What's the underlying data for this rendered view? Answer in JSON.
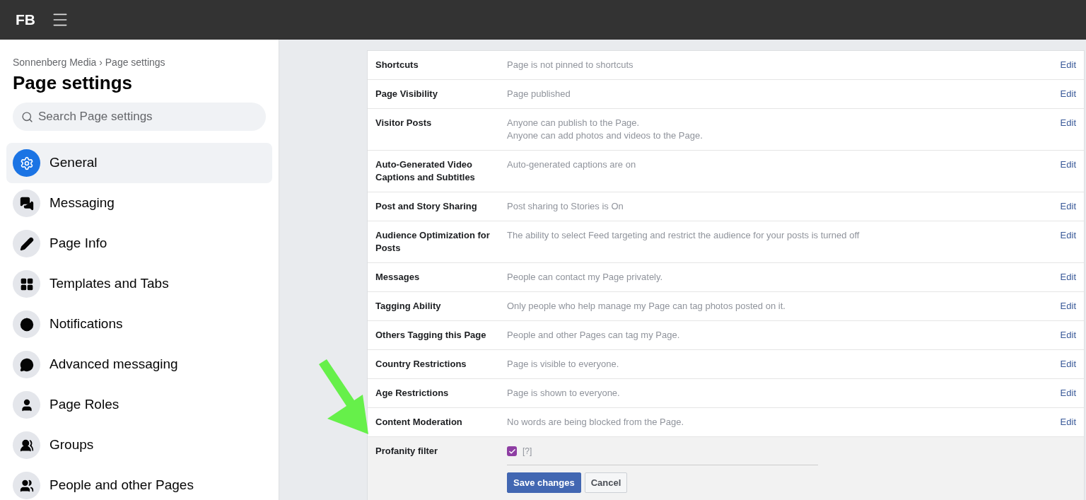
{
  "topbar": {
    "logo": "FB"
  },
  "sidebar": {
    "breadcrumb": "Sonnenberg Media › Page settings",
    "title": "Page settings",
    "search": {
      "placeholder": "Search Page settings"
    },
    "items": [
      {
        "label": "General",
        "selected": true
      },
      {
        "label": "Messaging",
        "selected": false
      },
      {
        "label": "Page Info",
        "selected": false
      },
      {
        "label": "Templates and Tabs",
        "selected": false
      },
      {
        "label": "Notifications",
        "selected": false
      },
      {
        "label": "Advanced messaging",
        "selected": false
      },
      {
        "label": "Page Roles",
        "selected": false
      },
      {
        "label": "Groups",
        "selected": false
      },
      {
        "label": "People and other Pages",
        "selected": false
      }
    ]
  },
  "settings": [
    {
      "kind": "setting",
      "name": "Shortcuts",
      "lines": [
        "Page is not pinned to shortcuts"
      ],
      "action": "Edit"
    },
    {
      "kind": "setting",
      "name": "Page Visibility",
      "lines": [
        "Page published"
      ],
      "action": "Edit"
    },
    {
      "kind": "setting",
      "name": "Visitor Posts",
      "lines": [
        "Anyone can publish to the Page.",
        "Anyone can add photos and videos to the Page."
      ],
      "action": "Edit"
    },
    {
      "kind": "setting",
      "name": "Auto-Generated Video Captions and Subtitles",
      "lines": [
        "Auto-generated captions are on"
      ],
      "action": "Edit"
    },
    {
      "kind": "setting",
      "name": "Post and Story Sharing",
      "lines": [
        "Post sharing to Stories is On"
      ],
      "action": "Edit"
    },
    {
      "kind": "setting",
      "name": "Audience Optimization for Posts",
      "lines": [
        "The ability to select Feed targeting and restrict the audience for your posts is turned off"
      ],
      "action": "Edit"
    },
    {
      "kind": "setting",
      "name": "Messages",
      "lines": [
        "People can contact my Page privately."
      ],
      "action": "Edit"
    },
    {
      "kind": "setting",
      "name": "Tagging Ability",
      "lines": [
        "Only people who help manage my Page can tag photos posted on it."
      ],
      "action": "Edit"
    },
    {
      "kind": "setting",
      "name": "Others Tagging this Page",
      "lines": [
        "People and other Pages can tag my Page."
      ],
      "action": "Edit"
    },
    {
      "kind": "setting",
      "name": "Country Restrictions",
      "lines": [
        "Page is visible to everyone."
      ],
      "action": "Edit"
    },
    {
      "kind": "setting",
      "name": "Age Restrictions",
      "lines": [
        "Page is shown to everyone."
      ],
      "action": "Edit"
    },
    {
      "kind": "setting",
      "name": "Content Moderation",
      "lines": [
        "No words are being blocked from the Page."
      ],
      "action": "Edit"
    },
    {
      "kind": "checkbox",
      "name": "Profanity filter",
      "checked": true,
      "help": "[?]",
      "buttons": [
        "Save changes",
        "Cancel"
      ]
    }
  ]
}
